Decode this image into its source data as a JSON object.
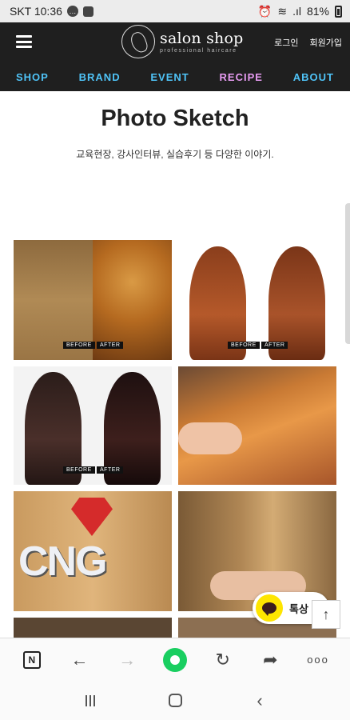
{
  "status_bar": {
    "carrier_time": "SKT 10:36",
    "battery": "81%"
  },
  "header": {
    "logo_main": "salon shop",
    "logo_sub": "professional  haircare",
    "links": {
      "login": "로그인",
      "signup": "회원가입"
    },
    "nav": [
      {
        "label": "SHOP",
        "color": "#4fc3f7"
      },
      {
        "label": "BRAND",
        "color": "#4fc3f7"
      },
      {
        "label": "EVENT",
        "color": "#4fc3f7"
      },
      {
        "label": "RECIPE",
        "color": "#e79bf2"
      },
      {
        "label": "ABOUT",
        "color": "#4fc3f7"
      }
    ]
  },
  "page": {
    "title": "Photo Sketch",
    "subtitle": "교육현장, 강사인터뷰, 실습후기 등 다양한 이야기."
  },
  "gallery": {
    "before_label": "BEFORE",
    "after_label": "AFTER",
    "sign_text": "CNG"
  },
  "floating": {
    "chat_label": "톡상",
    "top_icon": "↑"
  },
  "browser_bar": {
    "n_label": "N",
    "back": "←",
    "forward": "→",
    "refresh": "↻",
    "share": "➦",
    "more": "ooo"
  },
  "android_nav": {
    "back": "‹"
  }
}
